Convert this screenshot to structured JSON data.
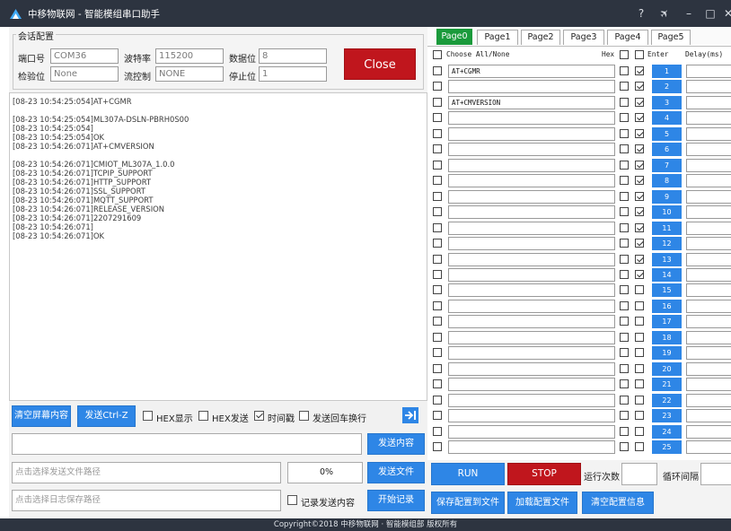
{
  "window": {
    "title": "中移物联网 - 智能模组串口助手",
    "help_icon": "?",
    "pin_icon": "✈",
    "minimize_icon": "–",
    "maximize_icon": "□",
    "close_icon": "✕"
  },
  "session": {
    "group_title": "会话配置",
    "port_label": "端口号",
    "port_value": "COM36",
    "baud_label": "波特率",
    "baud_value": "115200",
    "databits_label": "数据位",
    "databits_value": "8",
    "parity_label": "检验位",
    "parity_value": "None",
    "flow_label": "流控制",
    "flow_value": "NONE",
    "stopbits_label": "停止位",
    "stopbits_value": "1",
    "close_label": "Close"
  },
  "log": {
    "lines": [
      "[08-23 10:54:25:054]AT+CGMR",
      "",
      "[08-23 10:54:25:054]ML307A-DSLN-PBRH0S00",
      "[08-23 10:54:25:054]",
      "[08-23 10:54:25:054]OK",
      "[08-23 10:54:26:071]AT+CMVERSION",
      "",
      "[08-23 10:54:26:071]CMIOT_ML307A_1.0.0",
      "[08-23 10:54:26:071]TCPIP_SUPPORT",
      "[08-23 10:54:26:071]HTTP_SUPPORT",
      "[08-23 10:54:26:071]SSL_SUPPORT",
      "[08-23 10:54:26:071]MQTT_SUPPORT",
      "[08-23 10:54:26:071]RELEASE_VERSION",
      "[08-23 10:54:26:071]2207291609",
      "[08-23 10:54:26:071]",
      "[08-23 10:54:26:071]OK"
    ]
  },
  "controls": {
    "clear_screen": "清空屏幕内容",
    "send_ctrlz": "发送Ctrl-Z",
    "hex_display": "HEX显示",
    "hex_display_checked": false,
    "hex_send": "HEX发送",
    "hex_send_checked": false,
    "timestamp": "时间戳",
    "timestamp_checked": true,
    "send_newline": "发送回车换行",
    "send_newline_checked": false,
    "send_content_btn": "发送内容",
    "send_input_value": "",
    "file_path_placeholder": "点击选择发送文件路径",
    "file_progress": "0%",
    "send_file_btn": "发送文件",
    "log_path_placeholder": "点击选择日志保存路径",
    "record_label": "记录发送内容",
    "record_checked": false,
    "start_record_btn": "开始记录"
  },
  "tabs": [
    "Page0",
    "Page1",
    "Page2",
    "Page3",
    "Page4",
    "Page5"
  ],
  "active_tab": 0,
  "grid_header": {
    "choose_all": "Choose All/None",
    "hex": "Hex",
    "enter": "Enter",
    "delay": "Delay(ms)"
  },
  "commands": [
    {
      "n": "1",
      "cmd": "AT+CGMR",
      "hex": false,
      "enter": true,
      "sel": false
    },
    {
      "n": "2",
      "cmd": "",
      "hex": false,
      "enter": true,
      "sel": false
    },
    {
      "n": "3",
      "cmd": "AT+CMVERSION",
      "hex": false,
      "enter": true,
      "sel": false
    },
    {
      "n": "4",
      "cmd": "",
      "hex": false,
      "enter": true,
      "sel": false
    },
    {
      "n": "5",
      "cmd": "",
      "hex": false,
      "enter": true,
      "sel": false
    },
    {
      "n": "6",
      "cmd": "",
      "hex": false,
      "enter": true,
      "sel": false
    },
    {
      "n": "7",
      "cmd": "",
      "hex": false,
      "enter": true,
      "sel": false
    },
    {
      "n": "8",
      "cmd": "",
      "hex": false,
      "enter": true,
      "sel": false
    },
    {
      "n": "9",
      "cmd": "",
      "hex": false,
      "enter": true,
      "sel": false
    },
    {
      "n": "10",
      "cmd": "",
      "hex": false,
      "enter": true,
      "sel": false
    },
    {
      "n": "11",
      "cmd": "",
      "hex": false,
      "enter": true,
      "sel": false
    },
    {
      "n": "12",
      "cmd": "",
      "hex": false,
      "enter": true,
      "sel": false
    },
    {
      "n": "13",
      "cmd": "",
      "hex": false,
      "enter": true,
      "sel": false
    },
    {
      "n": "14",
      "cmd": "",
      "hex": false,
      "enter": true,
      "sel": false
    },
    {
      "n": "15",
      "cmd": "",
      "hex": false,
      "enter": false,
      "sel": false
    },
    {
      "n": "16",
      "cmd": "",
      "hex": false,
      "enter": false,
      "sel": false
    },
    {
      "n": "17",
      "cmd": "",
      "hex": false,
      "enter": false,
      "sel": false
    },
    {
      "n": "18",
      "cmd": "",
      "hex": false,
      "enter": false,
      "sel": false
    },
    {
      "n": "19",
      "cmd": "",
      "hex": false,
      "enter": false,
      "sel": false
    },
    {
      "n": "20",
      "cmd": "",
      "hex": false,
      "enter": false,
      "sel": false
    },
    {
      "n": "21",
      "cmd": "",
      "hex": false,
      "enter": false,
      "sel": false
    },
    {
      "n": "22",
      "cmd": "",
      "hex": false,
      "enter": false,
      "sel": false
    },
    {
      "n": "23",
      "cmd": "",
      "hex": false,
      "enter": false,
      "sel": false
    },
    {
      "n": "24",
      "cmd": "",
      "hex": false,
      "enter": false,
      "sel": false
    },
    {
      "n": "25",
      "cmd": "",
      "hex": false,
      "enter": false,
      "sel": false
    }
  ],
  "run_panel": {
    "run": "RUN",
    "stop": "STOP",
    "run_count_label": "运行次数",
    "loop_interval_label": "循环间隔",
    "save_config": "保存配置到文件",
    "load_config": "加载配置文件",
    "clear_config": "清空配置信息"
  },
  "statusbar": {
    "text": "Copyright©2018 中移物联网 · 智能模组部  版权所有"
  },
  "colors": {
    "titlebar": "#2d3440",
    "primary_blue": "#2e86e6",
    "close_red": "#c0161d",
    "stop_red": "#c0161d",
    "active_tab": "#1a9a3b"
  }
}
